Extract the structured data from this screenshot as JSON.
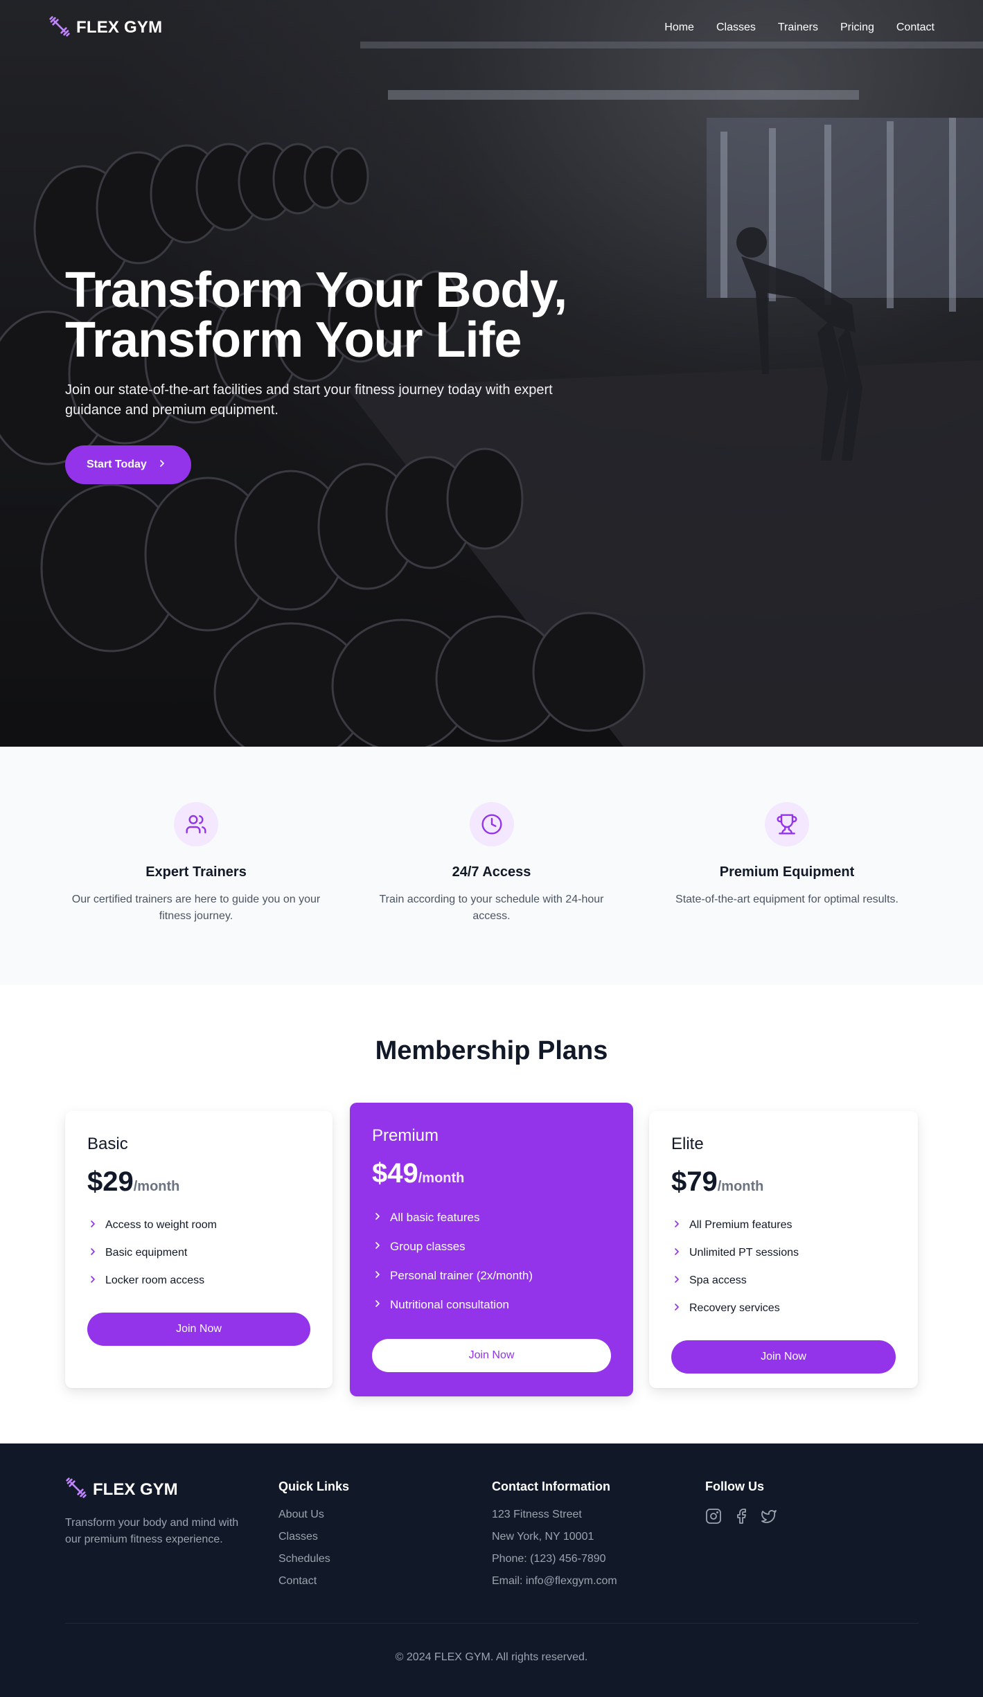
{
  "brand": {
    "name": "FLEX GYM",
    "accent": "#9333ea"
  },
  "nav": {
    "items": [
      "Home",
      "Classes",
      "Trainers",
      "Pricing",
      "Contact"
    ]
  },
  "hero": {
    "title_line1": "Transform Your Body,",
    "title_line2": "Transform Your Life",
    "subtitle": "Join our state-of-the-art facilities and start your fitness journey today with expert guidance and premium equipment.",
    "cta_label": "Start Today",
    "cta_icon": "chevron-right-icon",
    "background": "gym dumbbell rack photo"
  },
  "features": [
    {
      "icon": "users-icon",
      "title": "Expert Trainers",
      "text": "Our certified trainers are here to guide you on your fitness journey."
    },
    {
      "icon": "clock-icon",
      "title": "24/7 Access",
      "text": "Train according to your schedule with 24-hour access."
    },
    {
      "icon": "trophy-icon",
      "title": "Premium Equipment",
      "text": "State-of-the-art equipment for optimal results."
    }
  ],
  "pricing": {
    "title": "Membership Plans",
    "plans": [
      {
        "name": "Basic",
        "price": "$29",
        "period": "/month",
        "features": [
          "Access to weight room",
          "Basic equipment",
          "Locker room access"
        ],
        "button": "Join Now",
        "highlighted": false
      },
      {
        "name": "Premium",
        "price": "$49",
        "period": "/month",
        "features": [
          "All basic features",
          "Group classes",
          "Personal trainer (2x/month)",
          "Nutritional consultation"
        ],
        "button": "Join Now",
        "highlighted": true
      },
      {
        "name": "Elite",
        "price": "$79",
        "period": "/month",
        "features": [
          "All Premium features",
          "Unlimited PT sessions",
          "Spa access",
          "Recovery services"
        ],
        "button": "Join Now",
        "highlighted": false
      }
    ]
  },
  "footer": {
    "brand": "FLEX GYM",
    "about": "Transform your body and mind with our premium fitness experience.",
    "quick_links_title": "Quick Links",
    "quick_links": [
      "About Us",
      "Classes",
      "Schedules",
      "Contact"
    ],
    "contact_title": "Contact Information",
    "contact": [
      "123 Fitness Street",
      "New York, NY 10001",
      "Phone: (123) 456-7890",
      "Email: info@flexgym.com"
    ],
    "follow_title": "Follow Us",
    "social": [
      "instagram-icon",
      "facebook-icon",
      "twitter-icon"
    ],
    "copyright": "© 2024 FLEX GYM. All rights reserved."
  }
}
